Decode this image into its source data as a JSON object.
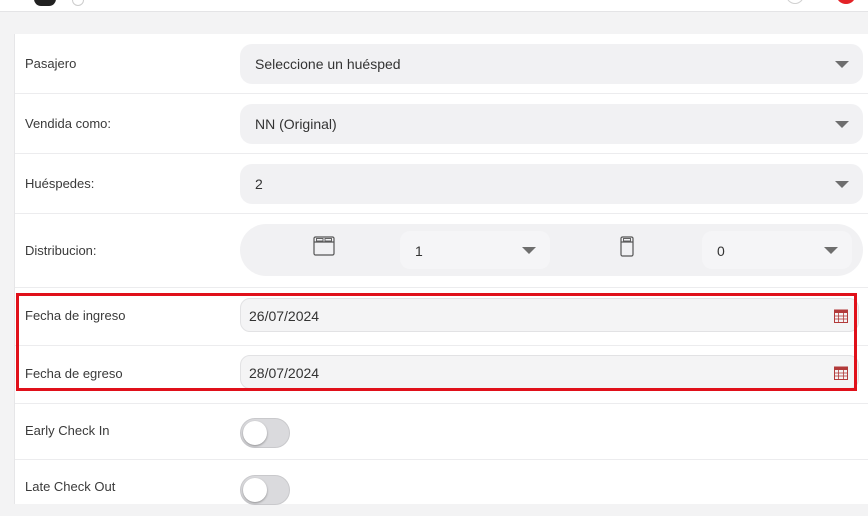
{
  "form": {
    "pasajero": {
      "label": "Pasajero",
      "value": "Seleccione un huésped"
    },
    "vendida_como": {
      "label": "Vendida como:",
      "value": "NN (Original)"
    },
    "huespedes": {
      "label": "Huéspedes:",
      "value": "2"
    },
    "distribucion": {
      "label": "Distribucion:",
      "double_bed": {
        "icon": "double-bed-icon",
        "value": "1"
      },
      "single_bed": {
        "icon": "single-bed-icon",
        "value": "0"
      }
    },
    "fecha_ingreso": {
      "label": "Fecha de ingreso",
      "value": "26/07/2024"
    },
    "fecha_egreso": {
      "label": "Fecha de egreso",
      "value": "28/07/2024"
    },
    "early_check_in": {
      "label": "Early Check In",
      "enabled": false
    },
    "late_check_out": {
      "label": "Late Check Out",
      "enabled": false
    }
  },
  "colors": {
    "highlight": "#e0101a",
    "calendar_icon": "#b23a3a",
    "field_bg": "#f1f1f3"
  }
}
